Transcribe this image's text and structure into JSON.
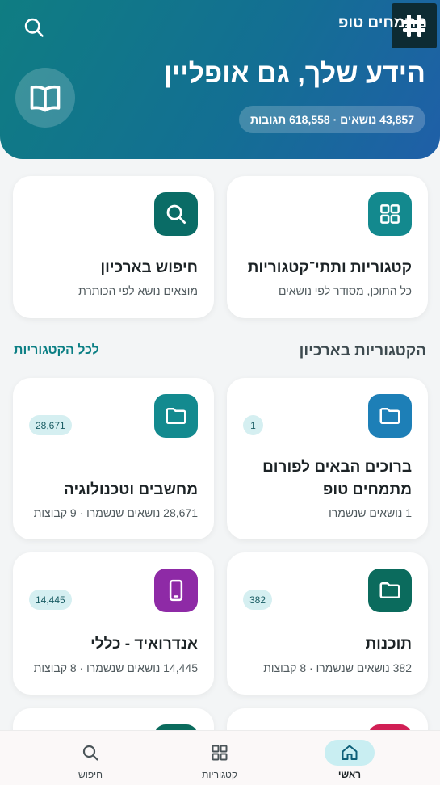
{
  "header": {
    "app_name": "מתמחים טופ",
    "title": "הידע שלך, גם אופליין",
    "stats": "43,857 נושאים · 618,558 תגובות",
    "colors": {
      "gradient_start": "#0f7d82",
      "gradient_end": "#1f5fa8"
    },
    "icons": {
      "search": "search-icon",
      "book": "book-icon",
      "logo": "hash-logo"
    }
  },
  "quick_actions": [
    {
      "title": "קטגוריות ותתי־קטגוריות",
      "subtitle": "כל התוכן, מסודר לפי נושאים",
      "icon": "grid-icon",
      "color": "#13898e"
    },
    {
      "title": "חיפוש בארכיון",
      "subtitle": "מוצאים נושא לפי הכותרת",
      "icon": "search-icon",
      "color": "#0a6c66"
    }
  ],
  "section": {
    "title": "הקטגוריות בארכיון",
    "link": "לכל הקטגוריות"
  },
  "categories": [
    {
      "title_line1": "ברוכים הבאים לפורום",
      "title_line2": "מתמחים טופ",
      "subtitle": "1 נושאים שנשמרו",
      "badge": "1",
      "icon": "folder-icon",
      "color": "#1d7fb7"
    },
    {
      "title_line1": "מחשבים וטכנולוגיה",
      "subtitle": "28,671 נושאים שנשמרו · 9 קבוצות",
      "badge": "28,671",
      "icon": "folder-icon",
      "color": "#138a8f"
    },
    {
      "title_line1": "תוכנות",
      "subtitle": "382 נושאים שנשמרו · 8 קבוצות",
      "badge": "382",
      "icon": "folder-icon",
      "color": "#0b6b5d"
    },
    {
      "title_line1": "אנדרואיד - כללי",
      "subtitle": "14,445 נושאים שנשמרו · 8 קבוצות",
      "badge": "14,445",
      "icon": "phone-icon",
      "color": "#8e2aa6"
    }
  ],
  "partial_cards": [
    {
      "color": "#d11f55"
    },
    {
      "color": "#0b6b5d"
    }
  ],
  "bottom_nav": [
    {
      "label": "ראשי",
      "icon": "home-icon",
      "active": true
    },
    {
      "label": "קטגוריות",
      "icon": "grid-icon",
      "active": false
    },
    {
      "label": "חיפוש",
      "icon": "search-icon",
      "active": false
    }
  ]
}
